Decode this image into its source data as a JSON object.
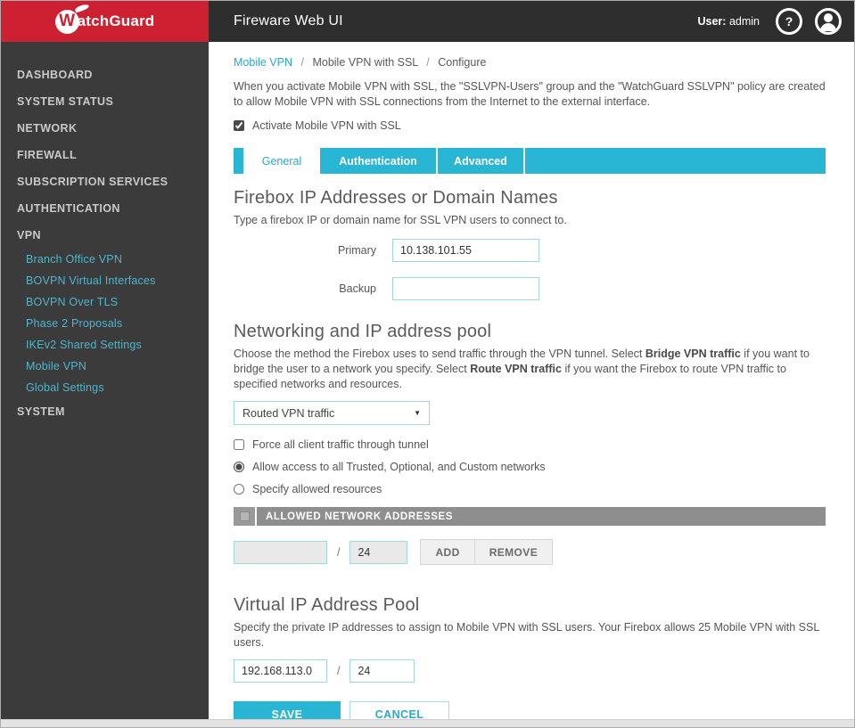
{
  "colors": {
    "accent": "#29b5d4",
    "brand_red": "#cd2030",
    "sidebar_bg": "#3b3b3b",
    "header_bg": "#2e2e2e",
    "table_header_bg": "#8e8e8e",
    "link_teal": "#2aa9c9"
  },
  "header": {
    "brand_w": "W",
    "brand_rest": "atchGuard",
    "title": "Fireware Web UI",
    "user_label": "User:",
    "user_name": "admin",
    "help_glyph": "?"
  },
  "sidebar": {
    "items": [
      {
        "label": "DASHBOARD"
      },
      {
        "label": "SYSTEM STATUS"
      },
      {
        "label": "NETWORK"
      },
      {
        "label": "FIREWALL"
      },
      {
        "label": "SUBSCRIPTION SERVICES"
      },
      {
        "label": "AUTHENTICATION"
      },
      {
        "label": "VPN"
      }
    ],
    "vpn_subitems": [
      {
        "label": "Branch Office VPN"
      },
      {
        "label": "BOVPN Virtual Interfaces"
      },
      {
        "label": "BOVPN Over TLS"
      },
      {
        "label": "Phase 2 Proposals"
      },
      {
        "label": "IKEv2 Shared Settings"
      },
      {
        "label": "Mobile VPN"
      },
      {
        "label": "Global Settings"
      }
    ],
    "bottom_item": "SYSTEM"
  },
  "breadcrumb": {
    "link": "Mobile VPN",
    "sep1": "/",
    "item2": "Mobile VPN with SSL",
    "sep2": "/",
    "item3": "Configure"
  },
  "intro": {
    "text": "When you activate Mobile VPN with SSL, the \"SSLVPN-Users\" group and the \"WatchGuard SSLVPN\" policy are created to allow Mobile VPN with SSL connections from the Internet to the external interface.",
    "activate_label": "Activate Mobile VPN with SSL",
    "activate_checked": "checked"
  },
  "tabs": [
    {
      "label": "General",
      "active": true
    },
    {
      "label": "Authentication",
      "active": false
    },
    {
      "label": "Advanced",
      "active": false
    }
  ],
  "firebox_section": {
    "title": "Firebox IP Addresses or Domain Names",
    "subtitle": "Type a firebox IP or domain name for SSL VPN users to connect to.",
    "primary_label": "Primary",
    "primary_value": "10.138.101.55",
    "backup_label": "Backup",
    "backup_value": ""
  },
  "networking_section": {
    "title": "Networking and IP address pool",
    "desc_part1": "Choose the method the Firebox uses to send traffic through the VPN tunnel. Select ",
    "bold1": "Bridge VPN traffic",
    "desc_part2": " if you want to bridge the user to a network you specify. Select ",
    "bold2": "Route VPN traffic",
    "desc_part3": " if you want the Firebox to route VPN traffic to specified networks and resources.",
    "dropdown_value": "Routed VPN traffic",
    "dropdown_arrow": "▼",
    "force_label": "Force all client traffic through tunnel",
    "radio_allow_label": "Allow access to all Trusted, Optional, and Custom networks",
    "radio_allow_checked": "checked",
    "radio_specify_label": "Specify allowed resources",
    "table_header": "ALLOWED NETWORK ADDRESSES",
    "network_value": "",
    "slash": "/",
    "mask_value": "24",
    "add_label": "ADD",
    "remove_label": "REMOVE"
  },
  "virtual_pool_section": {
    "title": "Virtual IP Address Pool",
    "desc": "Specify the private IP addresses to assign to Mobile VPN with SSL users. Your Firebox allows 25 Mobile VPN with SSL users.",
    "ip_value": "192.168.113.0",
    "slash": "/",
    "mask_value": "24"
  },
  "actions": {
    "save_label": "SAVE",
    "cancel_label": "CANCEL"
  }
}
